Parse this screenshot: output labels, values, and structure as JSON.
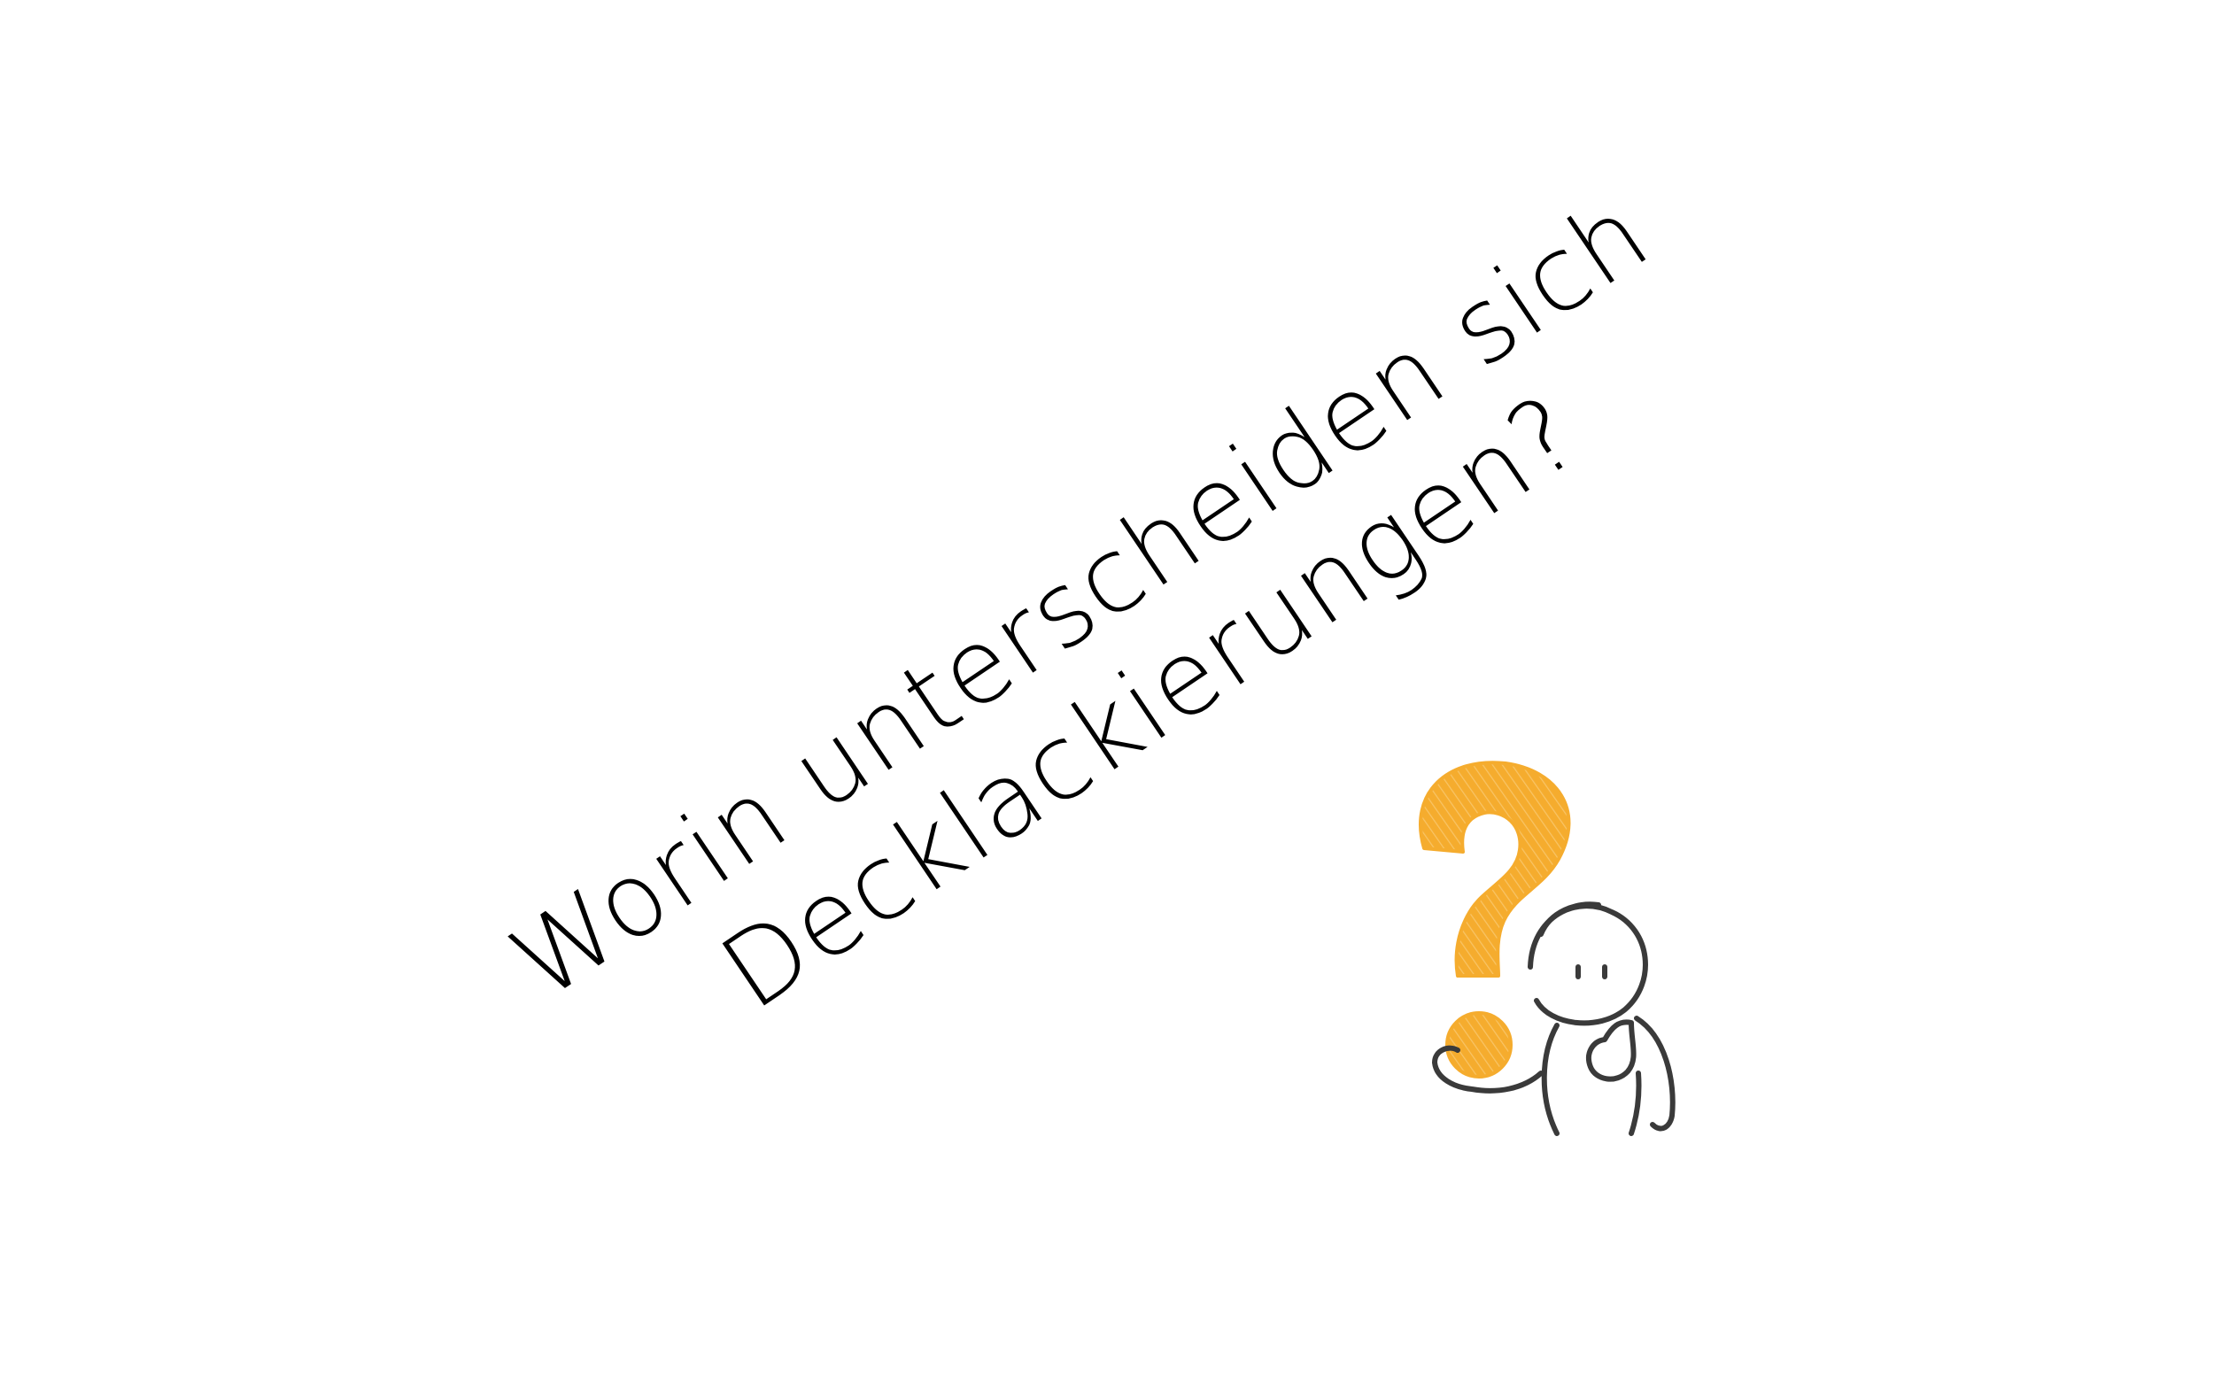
{
  "slide": {
    "title_line_1": "Worin unterscheiden sich",
    "title_line_2": "Decklackierungen?"
  },
  "illustration": {
    "icon": "thinking-person-with-question-mark-icon",
    "accent_color": "#F5AC2E",
    "line_color": "#3a3a3a"
  }
}
